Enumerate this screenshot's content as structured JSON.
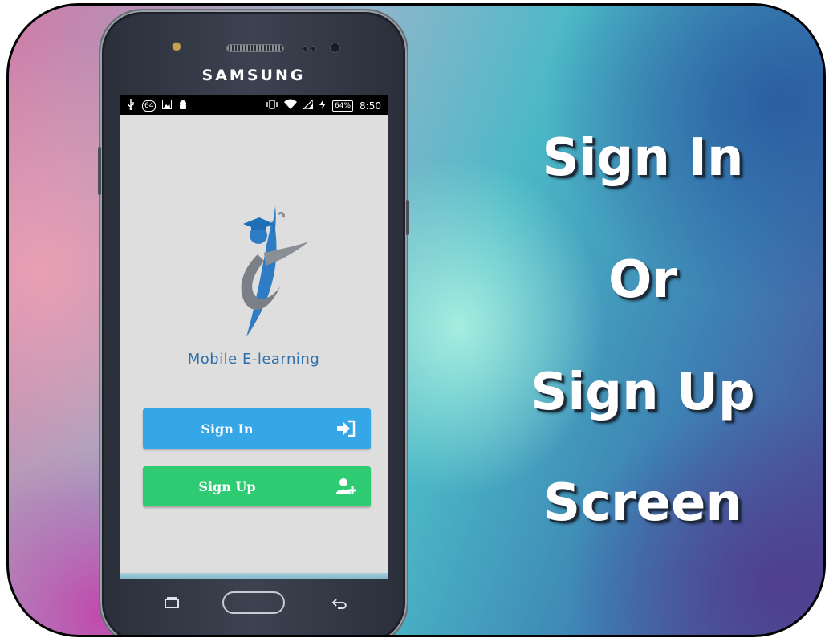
{
  "phone": {
    "brand": "SAMSUNG",
    "status_bar": {
      "left_icons": [
        "usb-icon",
        "badge-64-icon",
        "image-icon",
        "android-icon"
      ],
      "badge_text": "64",
      "battery": "64%",
      "time": "8:50"
    },
    "nav_icons": [
      "recent-apps-icon",
      "home-button",
      "back-icon"
    ]
  },
  "app": {
    "name": "Mobile E-learning",
    "sign_in_label": "Sign In",
    "sign_up_label": "Sign Up",
    "sign_in_color": "#35a6e6",
    "sign_up_color": "#2ecb73"
  },
  "headline": {
    "line1": "Sign In",
    "line2": "Or",
    "line3": "Sign Up",
    "line4": "Screen"
  }
}
